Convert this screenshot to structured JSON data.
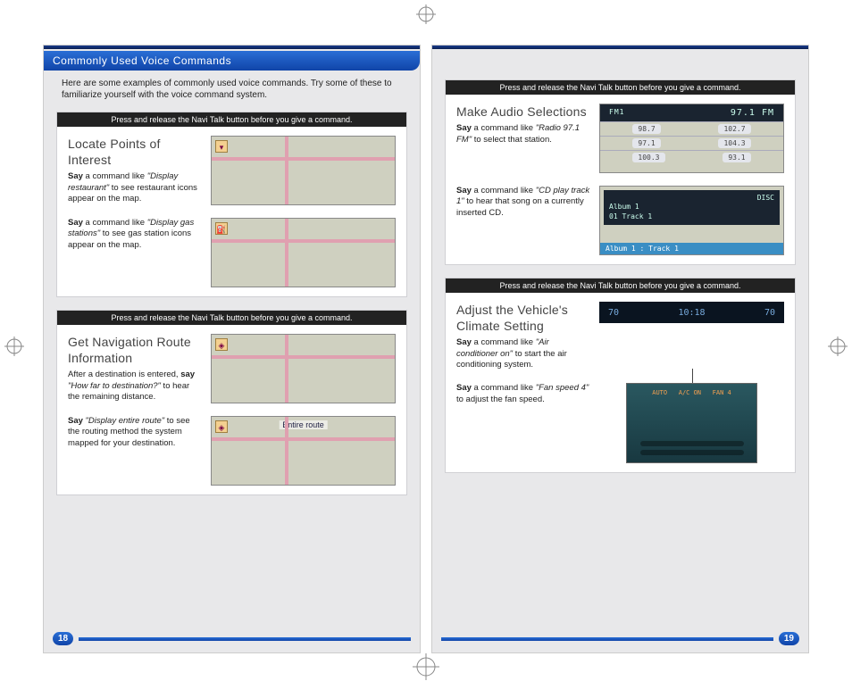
{
  "header": {
    "title": "Commonly Used Voice Commands"
  },
  "intro": "Here are some examples of commonly used voice commands. Try some of these to familiarize yourself with the voice command system.",
  "navi_note": "Press and release the Navi Talk button before you give a command.",
  "left": {
    "card1": {
      "title": "Locate Points of Interest",
      "item1_pre": "Say",
      "item1_mid": " a command like ",
      "item1_cmd": "\"Display restaurant\"",
      "item1_post": " to see restaurant icons appear on the map.",
      "item2_pre": "Say",
      "item2_mid": " a command like ",
      "item2_cmd": "\"Display gas stations\"",
      "item2_post": " to see gas station icons appear on the map."
    },
    "card2": {
      "title": "Get Navigation Route Information",
      "item1_pre": "After a destination is entered, ",
      "item1_say": "say",
      "item1_cmd": " \"How far to destination?\"",
      "item1_post": " to hear the remaining distance.",
      "item2_pre": "Say",
      "item2_cmd": " \"Display entire route\"",
      "item2_post": " to see the routing method the system mapped for your destination.",
      "map_label": "Entire route"
    },
    "page_num": "18"
  },
  "right": {
    "card1": {
      "title": "Make Audio Selections",
      "item1_pre": "Say",
      "item1_mid": " a command like ",
      "item1_cmd": "\"Radio 97.1 FM\"",
      "item1_post": " to select that station.",
      "radio_display": "97.1 FM",
      "radio_tag": "FM1",
      "presets": [
        "98.7",
        "102.7",
        "97.1",
        "104.3",
        "100.3",
        "93.1"
      ],
      "item2_pre": "Say",
      "item2_mid": " a command like ",
      "item2_cmd": "\"CD play track 1\"",
      "item2_post": " to hear that song on a currently inserted CD.",
      "cd_label": "DISC",
      "cd_lines": [
        "Album 1",
        "01 Track 1"
      ],
      "cd_footer": "Album 1 : Track 1"
    },
    "card2": {
      "title": "Adjust the Vehicle's Climate Setting",
      "item1_pre": "Say",
      "item1_mid": " a command like ",
      "item1_cmd": "\"Air conditioner on\"",
      "item1_post": " to start the air conditioning system.",
      "climate_left": "70",
      "climate_time": "10:18",
      "climate_right": "70",
      "item2_pre": "Say",
      "item2_mid": " a command like ",
      "item2_cmd": "\"Fan speed 4\"",
      "item2_post": " to adjust the fan speed."
    },
    "page_num": "19"
  }
}
